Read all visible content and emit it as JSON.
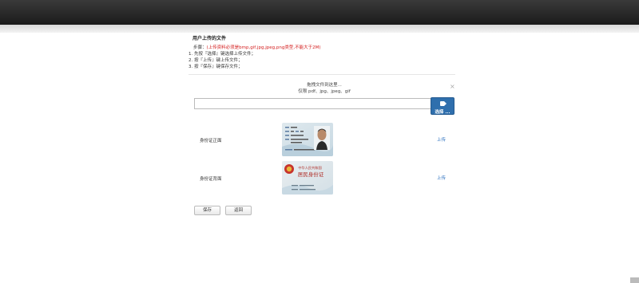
{
  "page": {
    "title": "用户上传的文件"
  },
  "instructions": {
    "prefix": "步骤：",
    "hint": "(上传资料必须是bmp,gif,jpg,jpeg,png类型,不能大于2M)",
    "steps": [
      "1. 先按『选择』键选择上传文件；",
      "2. 按『上传』键上传文件；",
      "3. 按『保存』键保存文件；"
    ]
  },
  "uploader": {
    "drop_text": "拖拽文件到这里...",
    "allowed_types": "仅限 pdf、jpg、jpeg、gif",
    "file_value": "",
    "choose_label": "选择 ...",
    "close_glyph": "×"
  },
  "documents": [
    {
      "label": "身份证正面",
      "action": "上传"
    },
    {
      "label": "身份证背面",
      "action": "上传"
    }
  ],
  "id_card_back": {
    "country": "中华人民共和国",
    "title": "居民身份证"
  },
  "buttons": {
    "save": "保存",
    "back": "返回"
  },
  "colors": {
    "hint": "#d42020",
    "link": "#2a6fbf",
    "primary_button": "#2f6fad"
  },
  "icons": {
    "choose": "upload-icon",
    "close": "close-icon"
  }
}
